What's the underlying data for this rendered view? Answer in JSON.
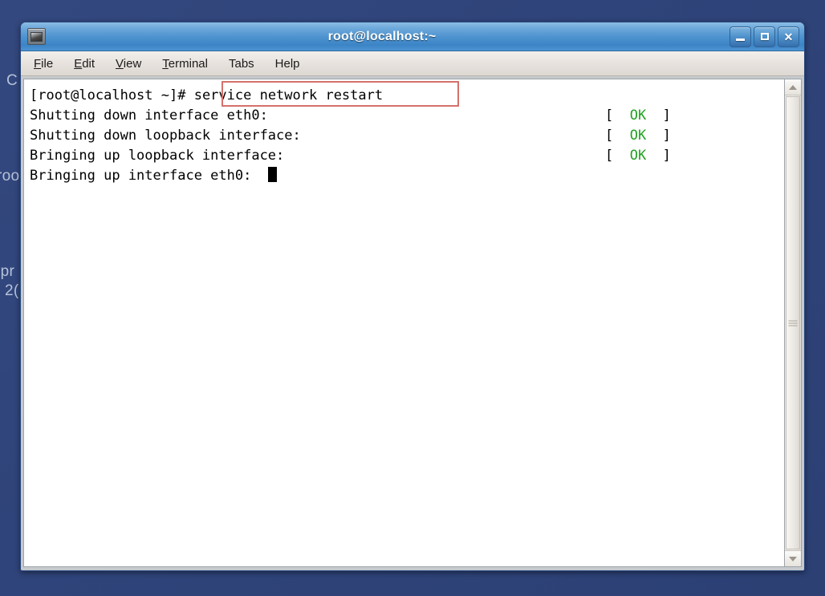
{
  "desktop": {
    "background_fragments": [
      {
        "id": "frag-c",
        "text": "C"
      },
      {
        "id": "frag-roo",
        "text": "roo"
      },
      {
        "id": "frag-rpr",
        "text": "rpr"
      },
      {
        "id": "frag-20",
        "text": "2("
      }
    ],
    "background_color": "#2f447a"
  },
  "window": {
    "title": "root@localhost:~",
    "icon_name": "terminal-icon",
    "controls": {
      "minimize_label": "_",
      "maximize_label": "□",
      "close_label": "✕"
    },
    "titlebar_color": "#4d93cf"
  },
  "menubar": {
    "items": [
      {
        "mnemonic": "F",
        "rest": "ile"
      },
      {
        "mnemonic": "E",
        "rest": "dit"
      },
      {
        "mnemonic": "V",
        "rest": "iew"
      },
      {
        "mnemonic": "T",
        "rest": "erminal"
      },
      {
        "mnemonic": "",
        "rest": "Tabs"
      },
      {
        "mnemonic": "",
        "rest": "Help"
      }
    ]
  },
  "terminal": {
    "prompt": "[root@localhost ~]# ",
    "command": "service network restart",
    "highlight_color": "#d4716b",
    "ok_color": "#21a121",
    "lines": [
      {
        "text": "Shutting down interface eth0:",
        "status": "[  OK  ]"
      },
      {
        "text": "Shutting down loopback interface:",
        "status": "[  OK  ]"
      },
      {
        "text": "Bringing up loopback interface:",
        "status": "[  OK  ]"
      },
      {
        "text": "Bringing up interface eth0:  ",
        "status": ""
      }
    ],
    "cursor": "block"
  },
  "scrollbar": {
    "up_arrow": "▲",
    "down_arrow": "▼",
    "position": "top"
  }
}
